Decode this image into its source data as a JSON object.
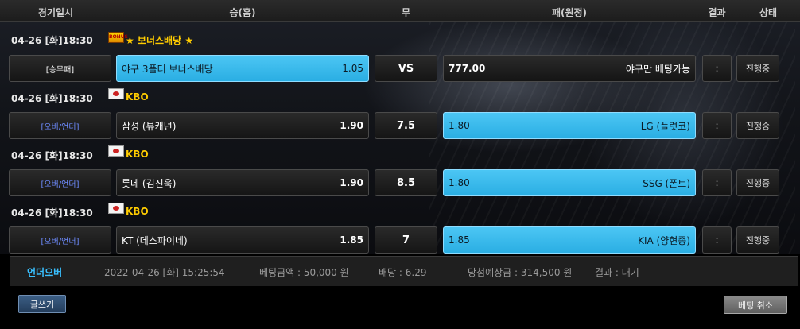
{
  "header": {
    "col_datetime": "경기일시",
    "col_home": "승(홈)",
    "col_draw": "무",
    "col_away": "패(원정)",
    "col_result": "결과",
    "col_status": "상태"
  },
  "games": [
    {
      "datetime": "04-26 [화]18:30",
      "league": "★ 보너스배당 ★",
      "league_icon": "bonus-logo-icon",
      "type": "[승무패]",
      "home_team": "야구 3폴더 보너스배당",
      "home_odds": "1.05",
      "mid": "VS",
      "away_odds": "777.00",
      "away_team": "야구만 베팅가능",
      "result": ":",
      "status": "진행중",
      "selected": "home"
    },
    {
      "datetime": "04-26 [화]18:30",
      "league": "KBO",
      "league_icon": "kbo-logo-icon",
      "type": "[오버/언더]",
      "home_team": "삼성 (뷰캐넌)",
      "home_odds": "1.90",
      "mid": "7.5",
      "away_odds": "1.80",
      "away_team": "LG (플럿코)",
      "result": ":",
      "status": "진행중",
      "selected": "away"
    },
    {
      "datetime": "04-26 [화]18:30",
      "league": "KBO",
      "league_icon": "kbo-logo-icon",
      "type": "[오버/언더]",
      "home_team": "롯데 (김진욱)",
      "home_odds": "1.90",
      "mid": "8.5",
      "away_odds": "1.80",
      "away_team": "SSG (폰트)",
      "result": ":",
      "status": "진행중",
      "selected": "away"
    },
    {
      "datetime": "04-26 [화]18:30",
      "league": "KBO",
      "league_icon": "kbo-logo-icon",
      "type": "[오버/언더]",
      "home_team": "KT (데스파이네)",
      "home_odds": "1.85",
      "mid": "7",
      "away_odds": "1.85",
      "away_team": "KIA (양현종)",
      "result": ":",
      "status": "진행중",
      "selected": "away"
    }
  ],
  "summary": {
    "bet_type": "언더오버",
    "datetime": "2022-04-26 [화] 15:25:54",
    "amount": "베팅금액 : 50,000 원",
    "odds": "배당 : 6.29",
    "expected": "당첨예상금 : 314,500 원",
    "result": "결과 : 대기"
  },
  "buttons": {
    "write": "글쓰기",
    "cancel": "베팅 취소"
  },
  "colors": {
    "selected": "#37b9ec",
    "league": "#ffcc00",
    "bet_type": "#39c0ff"
  }
}
